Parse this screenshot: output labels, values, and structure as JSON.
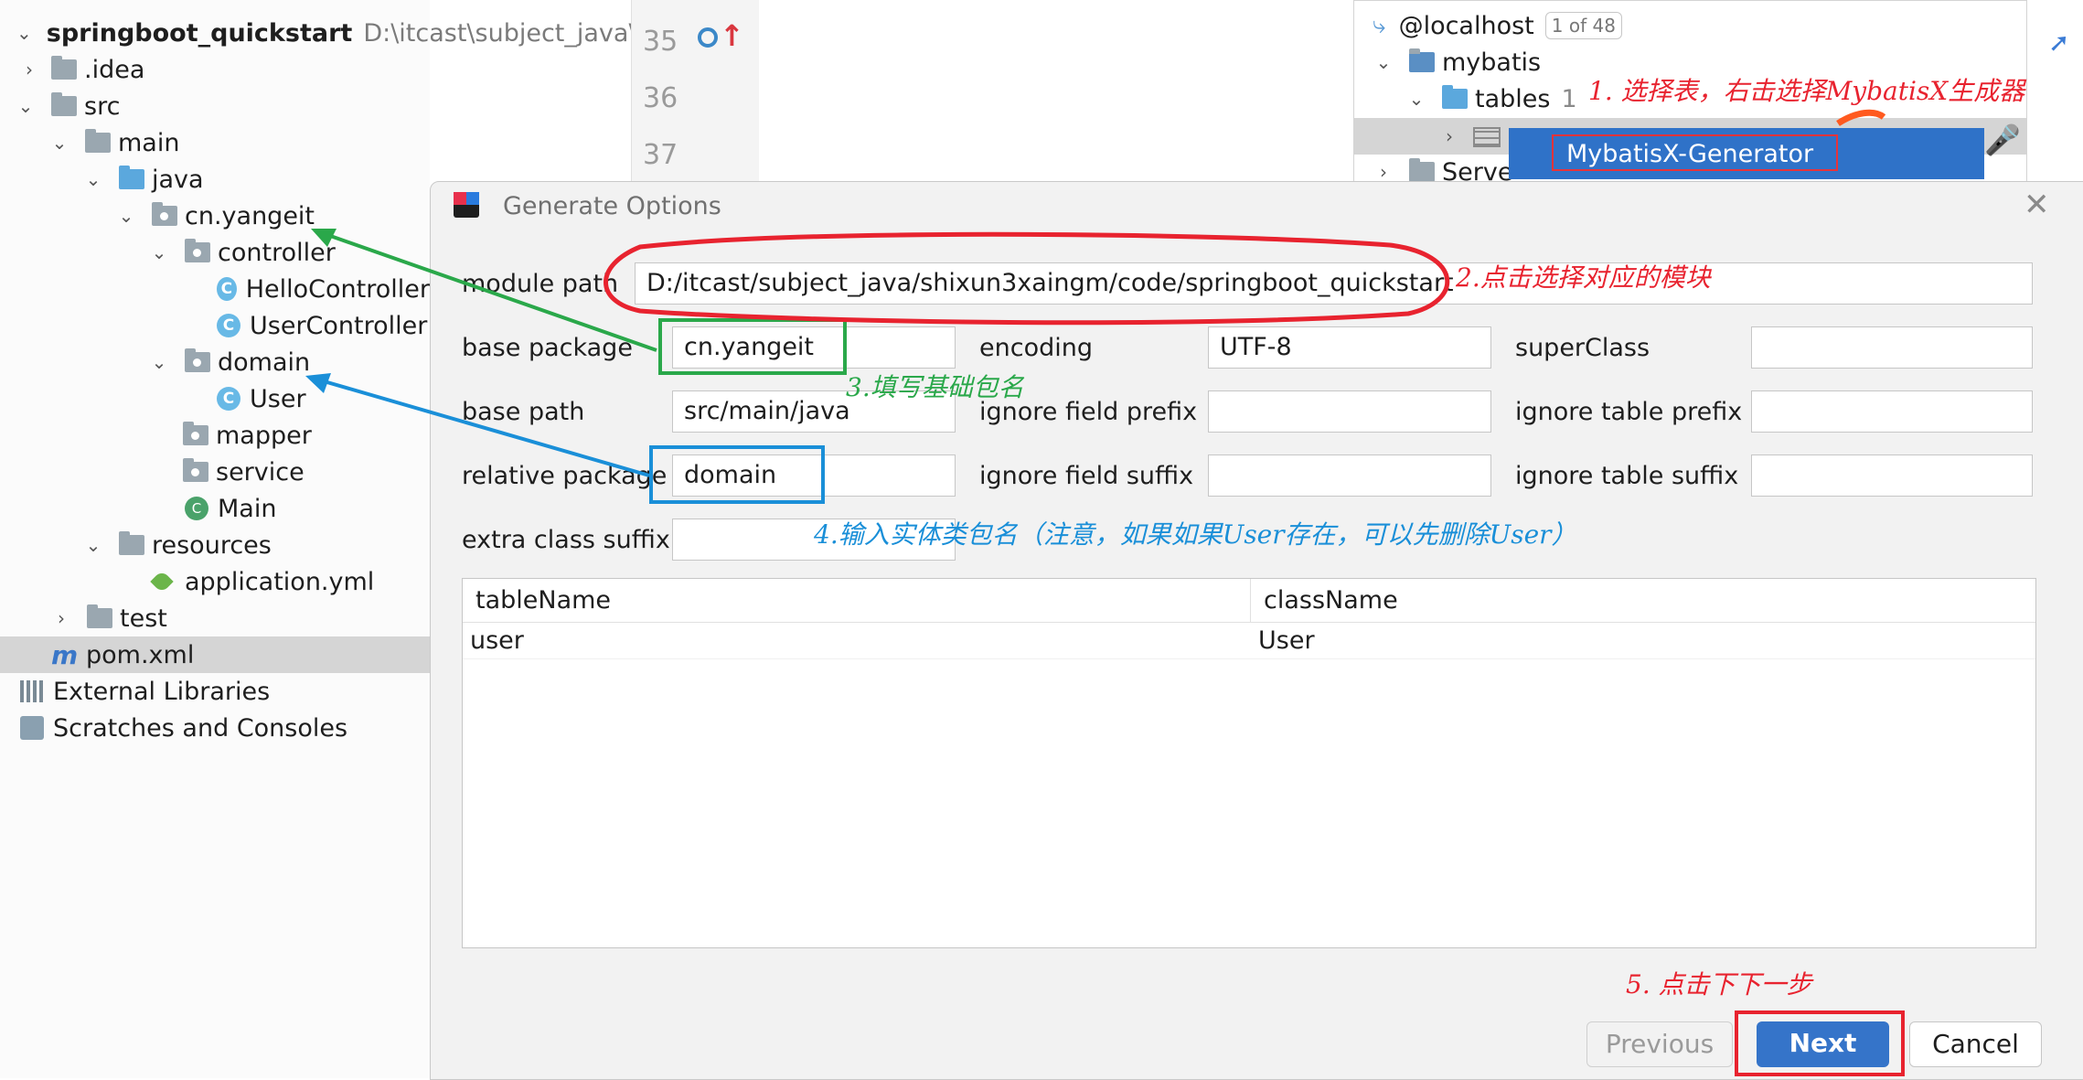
{
  "project_tree": {
    "module": {
      "name": "springboot_quickstart",
      "path": "D:\\itcast\\subject_java\\shixu"
    },
    "items": [
      {
        "label": ".idea"
      },
      {
        "label": "src"
      },
      {
        "label": "main"
      },
      {
        "label": "java"
      },
      {
        "label": "cn.yangeit"
      },
      {
        "label": "controller"
      },
      {
        "label": "HelloController"
      },
      {
        "label": "UserController"
      },
      {
        "label": "domain"
      },
      {
        "label": "User"
      },
      {
        "label": "mapper"
      },
      {
        "label": "service"
      },
      {
        "label": "Main"
      },
      {
        "label": "resources"
      },
      {
        "label": "application.yml"
      },
      {
        "label": "test"
      },
      {
        "label": "pom.xml"
      },
      {
        "label": "External Libraries"
      },
      {
        "label": "Scratches and Consoles"
      }
    ]
  },
  "editor": {
    "line_numbers": [
      "35",
      "36",
      "37"
    ]
  },
  "database": {
    "host": "@localhost",
    "host_badge": "1 of 48",
    "schema": "mybatis",
    "tables_label": "tables",
    "tables_count": "1",
    "servers_label": "Serve",
    "context_menu_item": "MybatisX-Generator"
  },
  "dialog": {
    "title": "Generate Options",
    "fields": {
      "module_path": {
        "label": "module path",
        "value": "D:/itcast/subject_java/shixun3xaingm/code/springboot_quickstart"
      },
      "base_package": {
        "label": "base package",
        "value": "cn.yangeit"
      },
      "encoding": {
        "label": "encoding",
        "value": "UTF-8"
      },
      "super_class": {
        "label": "superClass",
        "value": ""
      },
      "base_path": {
        "label": "base path",
        "value": "src/main/java"
      },
      "ignore_field_prefix": {
        "label": "ignore field prefix",
        "value": ""
      },
      "ignore_table_prefix": {
        "label": "ignore table prefix",
        "value": ""
      },
      "relative_package": {
        "label": "relative package",
        "value": "domain"
      },
      "ignore_field_suffix": {
        "label": "ignore field suffix",
        "value": ""
      },
      "ignore_table_suffix": {
        "label": "ignore table suffix",
        "value": ""
      },
      "extra_class_suffix": {
        "label": "extra class suffix",
        "value": ""
      }
    },
    "table": {
      "columns": [
        "tableName",
        "className"
      ],
      "rows": [
        {
          "tableName": "user",
          "className": "User"
        }
      ]
    },
    "buttons": {
      "previous": "Previous",
      "next": "Next",
      "cancel": "Cancel"
    }
  },
  "annotations": {
    "step1": "1. 选择表，右击选择MybatisX生成器",
    "step2": "2.点击选择对应的模块",
    "step3": "3.填写基础包名",
    "step4": "4.输入实体类包名（注意，如果如果User存在，可以先删除User）",
    "step5": "5. 点击下下一步"
  },
  "colors": {
    "red_annotation": "#e8232f",
    "green_annotation": "#2aa84a",
    "blue_annotation": "#1a8fd8",
    "primary_button": "#3574c9",
    "context_menu": "#2f72c8"
  }
}
